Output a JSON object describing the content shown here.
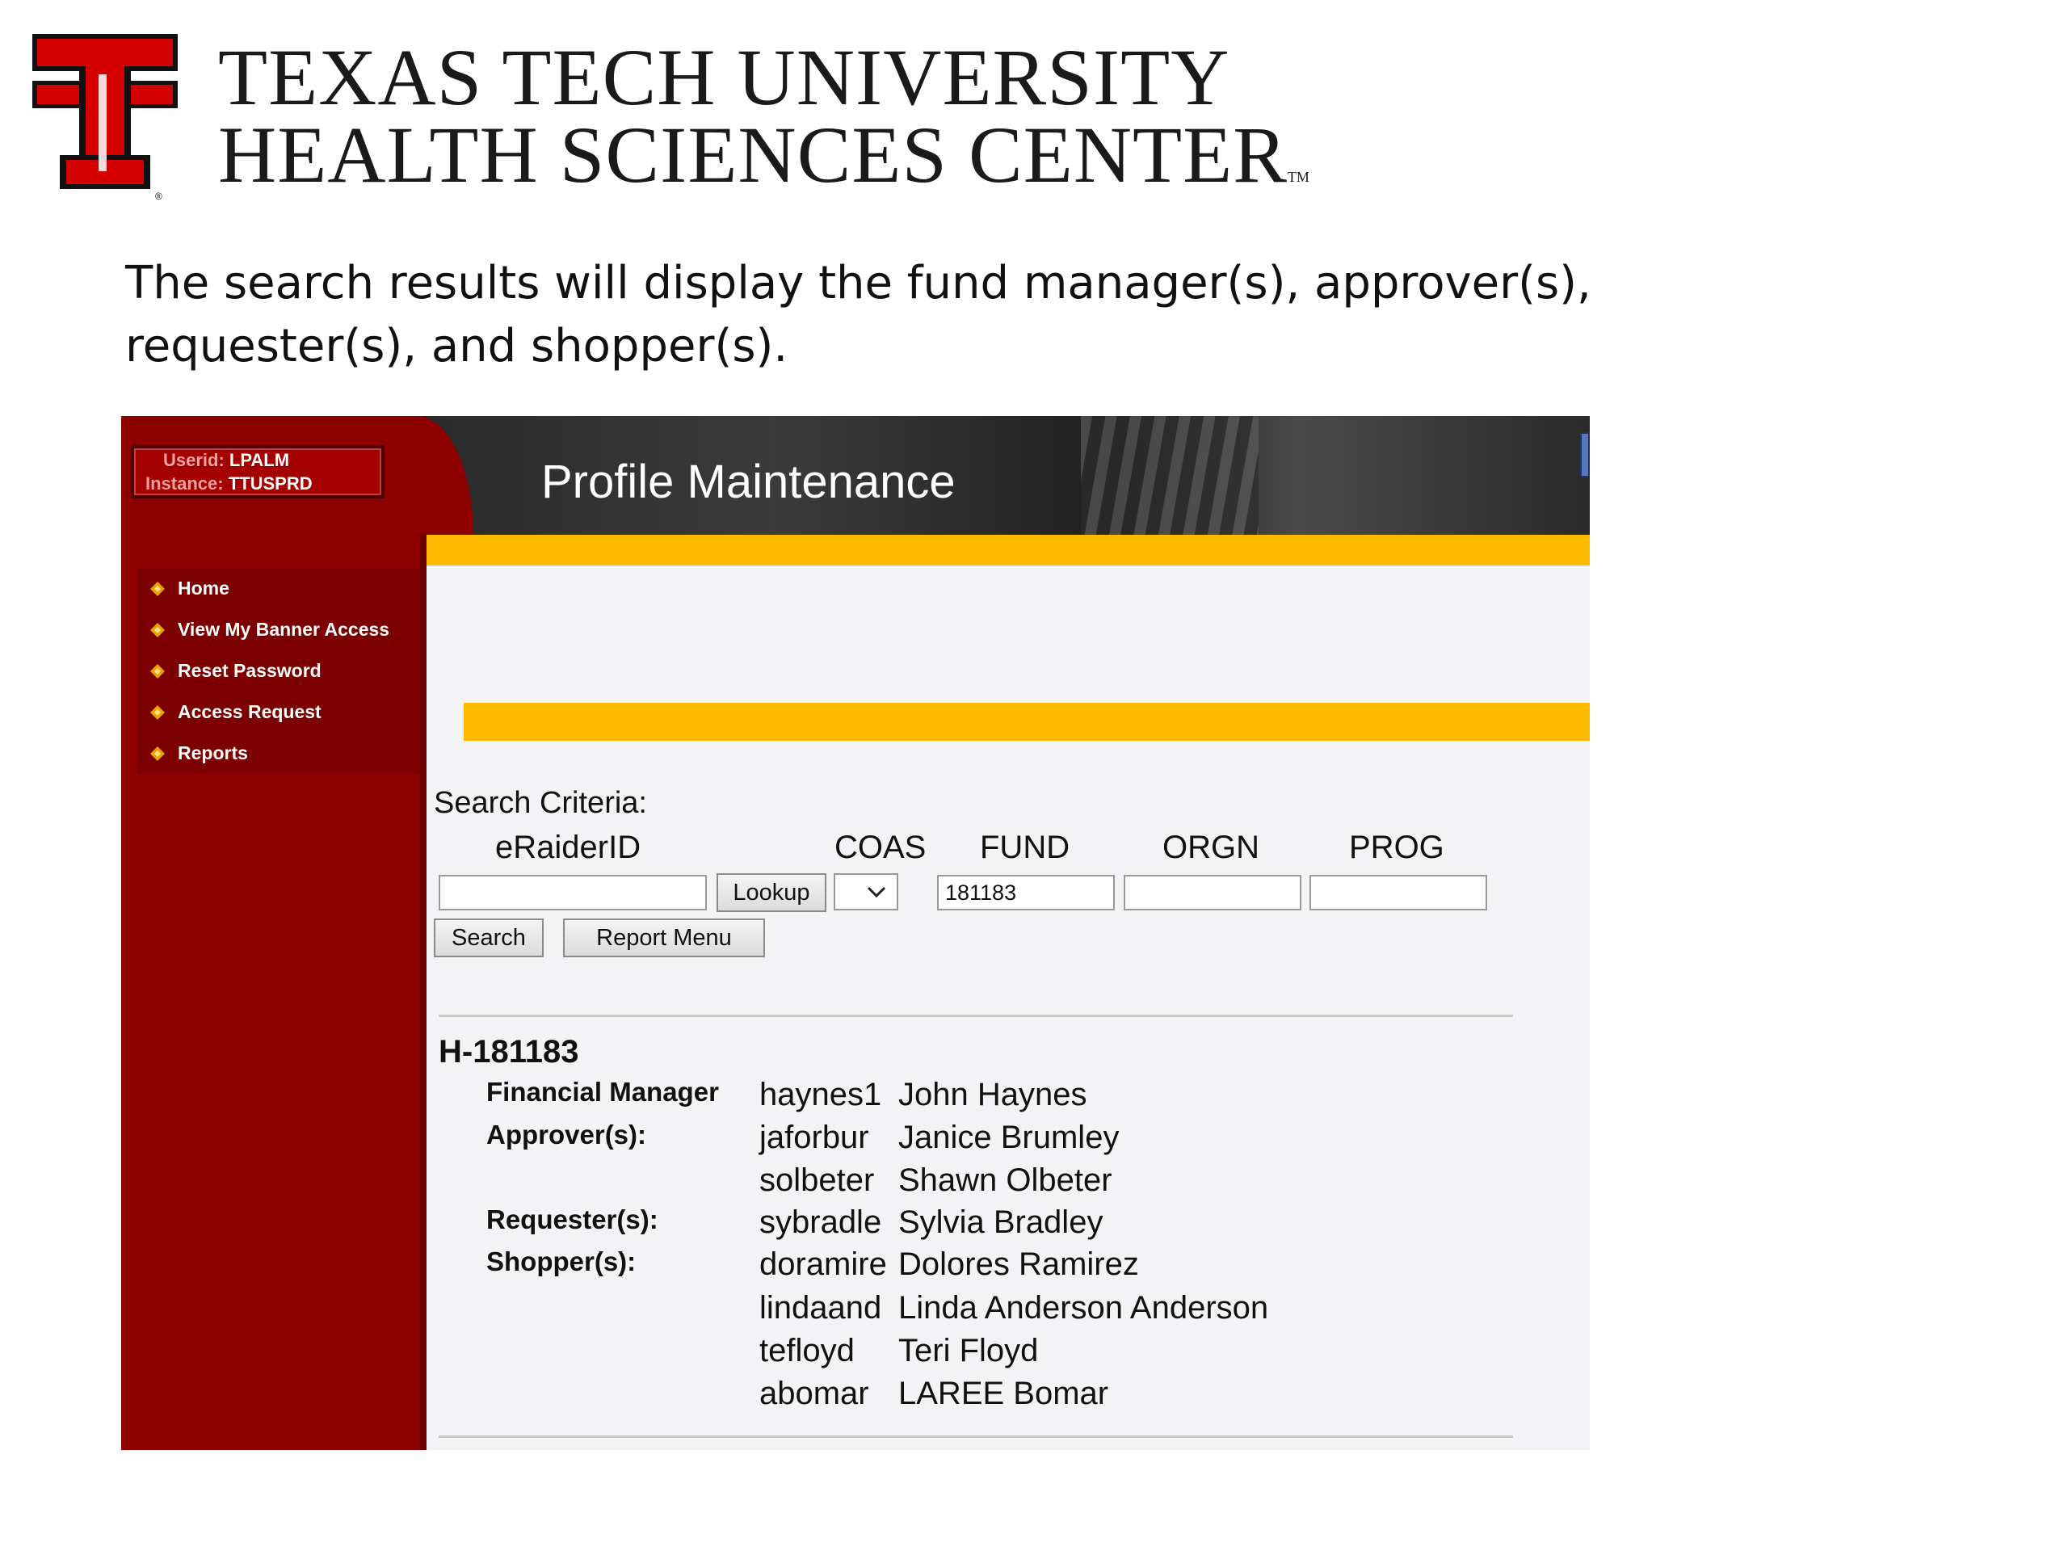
{
  "institution": {
    "name_line1": "TEXAS TECH UNIVERSITY",
    "name_line2": "HEALTH SCIENCES CENTER",
    "trademark": "TM",
    "registered": "®"
  },
  "caption": "The search results will display the fund manager(s), approver(s), requester(s), and shopper(s).",
  "app": {
    "title": "Profile Maintenance",
    "user": {
      "userid_label": "Userid:",
      "userid": "LPALM",
      "instance_label": "Instance:",
      "instance": "TTUSPRD"
    },
    "nav": [
      "Home",
      "View My Banner Access",
      "Reset Password",
      "Access Request",
      "Reports"
    ],
    "colors": {
      "sidebar": "#8e0000",
      "gold": "#ffba00",
      "banner": "#2a2a2a"
    }
  },
  "search": {
    "title": "Search Criteria:",
    "labels": {
      "eraiderid": "eRaiderID",
      "coas": "COAS",
      "fund": "FUND",
      "orgn": "ORGN",
      "prog": "PROG"
    },
    "values": {
      "eraiderid": "",
      "coas": "",
      "fund": "181183",
      "orgn": "",
      "prog": ""
    },
    "buttons": {
      "lookup": "Lookup",
      "search": "Search",
      "report_menu": "Report Menu"
    }
  },
  "results": {
    "fund_id": "H-181183",
    "roles": {
      "financial_manager": "Financial Manager",
      "approvers": "Approver(s):",
      "requesters": "Requester(s):",
      "shoppers": "Shopper(s):"
    },
    "entries": [
      {
        "userid": "haynes1",
        "name": "John Haynes"
      },
      {
        "userid": "jaforbur",
        "name": "Janice Brumley"
      },
      {
        "userid": "solbeter",
        "name": "Shawn Olbeter"
      },
      {
        "userid": "sybradle",
        "name": "Sylvia Bradley"
      },
      {
        "userid": "doramire",
        "name": "Dolores Ramirez"
      },
      {
        "userid": "lindaand",
        "name": "Linda Anderson Anderson"
      },
      {
        "userid": "tefloyd",
        "name": "Teri Floyd"
      },
      {
        "userid": "abomar",
        "name": "LAREE Bomar"
      }
    ]
  }
}
